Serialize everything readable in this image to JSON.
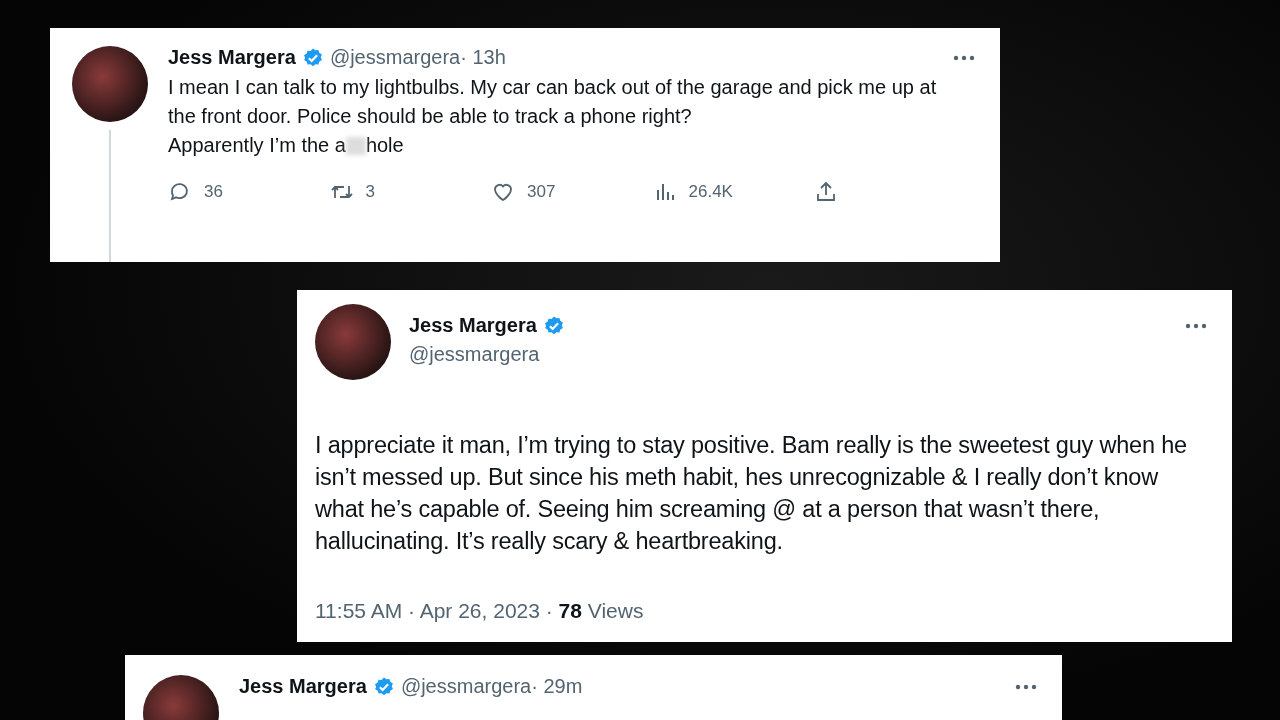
{
  "tweets": [
    {
      "kind": "compact",
      "name": "Jess Margera",
      "verified": true,
      "handle": "@jessmargera",
      "time": "· 13h",
      "thread_line": true,
      "text": "I mean I can talk to my lightbulbs. My car can back out of the garage and pick me up at the front door. Police should be able to track a phone right?",
      "text_before": "Apparently I’m the a",
      "censored": true,
      "text_after": "hole",
      "replies": "36",
      "retweets": "3",
      "likes": "307",
      "views": "26.4K"
    },
    {
      "kind": "detail",
      "name": "Jess Margera",
      "verified": true,
      "handle": "@jessmargera",
      "text": "I appreciate it man, I’m trying to stay positive. Bam really is the sweetest guy when he isn’t messed up. But since his meth habit, hes unrecognizable & I really don’t know what he’s capable of. Seeing him screaming @ at a person that wasn’t there, hallucinating. It’s really scary & heartbreaking.",
      "timestamp": "11:55 AM · Apr 26, 2023 · **78** Views"
    },
    {
      "kind": "cut",
      "name": "Jess Margera",
      "verified": true,
      "handle": "@jessmargera",
      "time": "· 29m"
    }
  ]
}
